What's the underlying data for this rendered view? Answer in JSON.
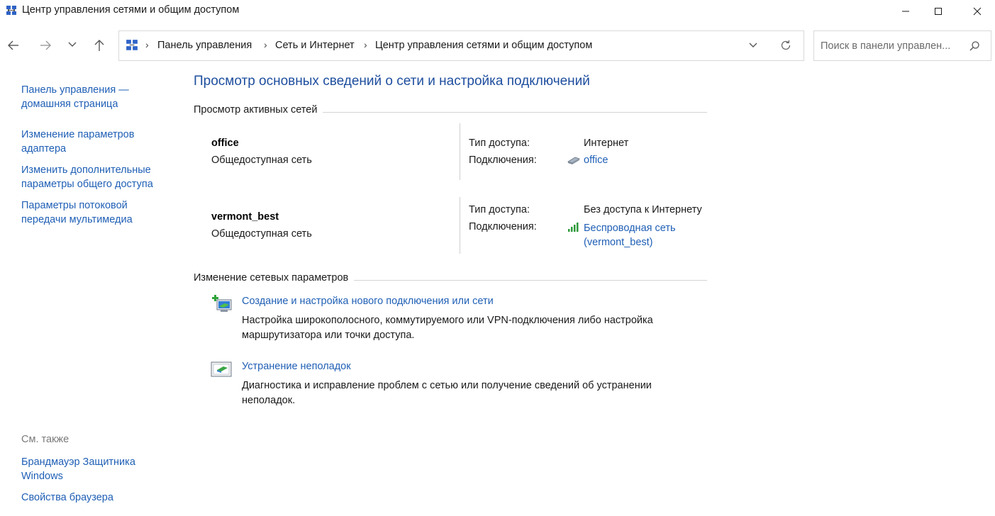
{
  "window": {
    "title": "Центр управления сетями и общим доступом"
  },
  "nav": {
    "breadcrumb": [
      "Панель управления",
      "Сеть и Интернет",
      "Центр управления сетями и общим доступом"
    ],
    "search_placeholder": "Поиск в панели управлен..."
  },
  "sidebar": {
    "items": [
      {
        "label": "Панель управления — домашняя страница"
      },
      {
        "label": "Изменение параметров адаптера"
      },
      {
        "label": "Изменить дополнительные параметры общего доступа"
      },
      {
        "label": "Параметры потоковой передачи мультимедиа"
      }
    ],
    "see_also_label": "См. также",
    "see_also": [
      {
        "label": "Брандмауэр Защитника Windows"
      },
      {
        "label": "Свойства браузера"
      }
    ]
  },
  "main": {
    "heading": "Просмотр основных сведений о сети и настройка подключений",
    "active_networks_title": "Просмотр активных сетей",
    "access_type_label": "Тип доступа:",
    "connections_label": "Подключения:",
    "networks": [
      {
        "name": "office",
        "category": "Общедоступная сеть",
        "access": "Интернет",
        "connection": "office"
      },
      {
        "name": "vermont_best",
        "category": "Общедоступная сеть",
        "access": "Без доступа к Интернету",
        "connection_line1": "Беспроводная сеть",
        "connection_line2": "(vermont_best)"
      }
    ],
    "change_settings_title": "Изменение сетевых параметров",
    "tasks": [
      {
        "title": "Создание и настройка нового подключения или сети",
        "desc_line1": "Настройка широкополосного, коммутируемого или VPN-подключения либо настройка",
        "desc_line2": "маршрутизатора или точки доступа."
      },
      {
        "title": "Устранение неполадок",
        "desc_line1": "Диагностика и исправление проблем с сетью или получение сведений об устранении",
        "desc_line2": "неполадок."
      }
    ]
  },
  "colors": {
    "link": "#1f5fb5",
    "heading": "#1e4e9e"
  }
}
